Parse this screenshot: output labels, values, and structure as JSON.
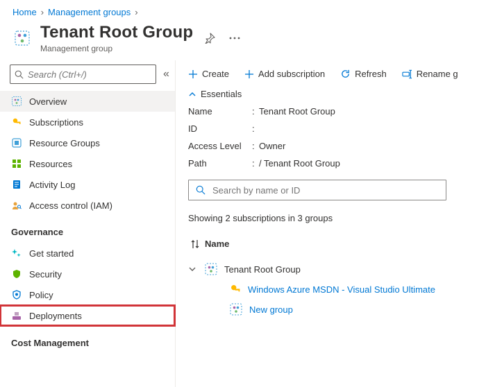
{
  "breadcrumb": [
    {
      "label": "Home"
    },
    {
      "label": "Management groups"
    }
  ],
  "header": {
    "title": "Tenant Root Group",
    "subtitle": "Management group"
  },
  "sidebar": {
    "search_placeholder": "Search (Ctrl+/)",
    "items": [
      {
        "label": "Overview",
        "icon": "mg"
      },
      {
        "label": "Subscriptions",
        "icon": "key"
      },
      {
        "label": "Resource Groups",
        "icon": "resource-group"
      },
      {
        "label": "Resources",
        "icon": "grid"
      },
      {
        "label": "Activity Log",
        "icon": "log"
      },
      {
        "label": "Access control (IAM)",
        "icon": "iam"
      }
    ],
    "governance_label": "Governance",
    "governance_items": [
      {
        "label": "Get started",
        "icon": "sparkle"
      },
      {
        "label": "Security",
        "icon": "shield"
      },
      {
        "label": "Policy",
        "icon": "policy"
      },
      {
        "label": "Deployments",
        "icon": "deploy"
      }
    ],
    "cost_label": "Cost Management"
  },
  "toolbar": {
    "create": "Create",
    "add_subscription": "Add subscription",
    "refresh": "Refresh",
    "rename": "Rename g"
  },
  "essentials": {
    "heading": "Essentials",
    "rows": {
      "name_label": "Name",
      "name_value": "Tenant Root Group",
      "id_label": "ID",
      "id_value": "",
      "access_label": "Access Level",
      "access_value": "Owner",
      "path_label": "Path",
      "path_value": "/ Tenant Root Group"
    }
  },
  "main_search_placeholder": "Search by name or ID",
  "showing_text": "Showing 2 subscriptions in 3 groups",
  "name_header": "Name",
  "tree": {
    "root_label": "Tenant Root Group",
    "sub1": "Windows Azure MSDN - Visual Studio Ultimate",
    "sub2": "New group"
  }
}
